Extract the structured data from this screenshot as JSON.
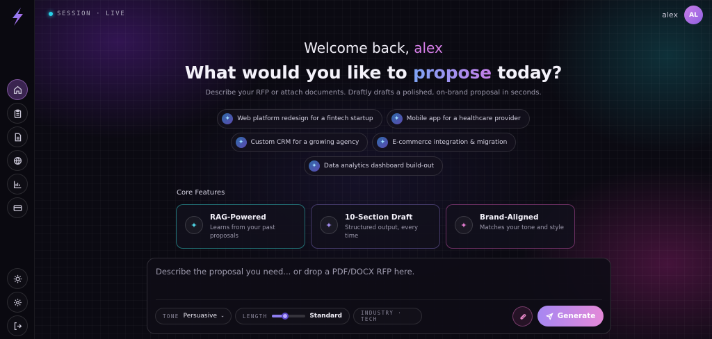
{
  "topbar": {
    "session_label": "SESSION · LIVE",
    "user_name": "alex",
    "avatar_initials": "AL"
  },
  "hero": {
    "welcome_prefix": "Welcome back, ",
    "welcome_name": "alex",
    "headline_before": "What would you like to ",
    "headline_accent": "propose",
    "headline_after": " today?",
    "subline": "Describe your RFP or attach documents. Draftly drafts a polished, on-brand proposal in seconds."
  },
  "suggestions": [
    "Web platform redesign for a fintech startup",
    "Mobile app for a healthcare provider",
    "Custom CRM for a growing agency",
    "E-commerce integration & migration",
    "Data analytics dashboard build-out"
  ],
  "features": {
    "label": "Core Features",
    "items": [
      {
        "title": "RAG-Powered",
        "desc": "Learns from your past proposals"
      },
      {
        "title": "10-Section Draft",
        "desc": "Structured output, every time"
      },
      {
        "title": "Brand-Aligned",
        "desc": "Matches your tone and style"
      }
    ]
  },
  "composer": {
    "placeholder": "Describe the proposal you need... or drop a PDF/DOCX RFP here.",
    "tone_label": "TONE",
    "tone_value": "Persuasive",
    "length_label": "LENGTH",
    "length_value": "Standard",
    "length_level": 0.4,
    "industry_label": "INDUSTRY · TECH",
    "generate_label": "Generate"
  },
  "icons": {
    "logo": "bolt-logo-icon",
    "nav": [
      "home-icon",
      "clipboard-icon",
      "document-icon",
      "globe-icon",
      "bar-chart-icon",
      "credit-card-icon"
    ],
    "bottom": [
      "sun-icon",
      "gear-icon",
      "logout-icon"
    ]
  },
  "colors": {
    "accent_cyan": "#28d3ea",
    "accent_purple": "#a687f2",
    "accent_pink": "#e488d8",
    "background": "#0b0a12"
  }
}
